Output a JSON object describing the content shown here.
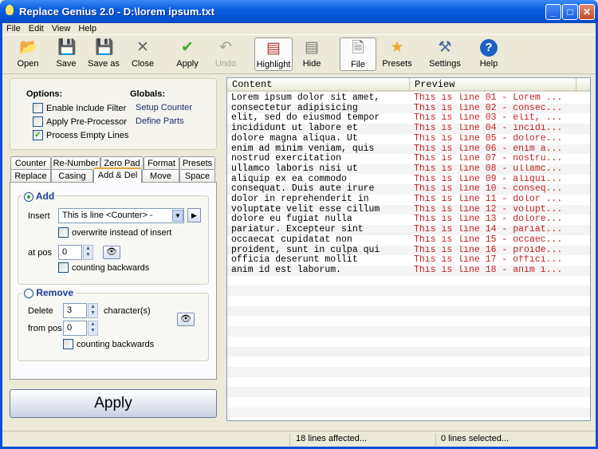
{
  "window": {
    "title": "Replace Genius 2.0 - D:\\lorem ipsum.txt",
    "controls": [
      "_",
      "□",
      "✕"
    ]
  },
  "menu": [
    "File",
    "Edit",
    "View",
    "Help"
  ],
  "toolbar": [
    {
      "label": "Open",
      "icon": "open-folder-icon",
      "glyph": "📂",
      "color": "#d9a520"
    },
    {
      "label": "Save",
      "icon": "floppy-save-icon",
      "glyph": "💾",
      "color": "#3a5c9c"
    },
    {
      "label": "Save as",
      "icon": "floppy-save-as-icon",
      "glyph": "💾",
      "color": "#3a5c9c"
    },
    {
      "label": "Close",
      "icon": "close-x-icon",
      "glyph": "✕",
      "color": "#666"
    },
    {
      "label": "Apply",
      "icon": "checkmark-icon",
      "glyph": "✔",
      "color": "#3cae2c"
    },
    {
      "label": "Undo",
      "icon": "undo-icon",
      "glyph": "↶",
      "color": "#a0a0a0",
      "disabled": true
    },
    {
      "label": "Highlight",
      "icon": "highlight-list-icon",
      "glyph": "▤",
      "color": "#b03030",
      "pressed": true
    },
    {
      "label": "Hide",
      "icon": "hide-list-icon",
      "glyph": "▤",
      "color": "#777"
    },
    {
      "label": "File",
      "icon": "file-icon",
      "glyph": "🗎",
      "color": "#666",
      "pressed": true
    },
    {
      "label": "Presets",
      "icon": "star-icon",
      "glyph": "★",
      "color": "#f5a623"
    },
    {
      "label": "Settings",
      "icon": "tools-icon",
      "glyph": "⚒",
      "color": "#4a6a9a"
    },
    {
      "label": "Help",
      "icon": "help-icon",
      "glyph": "?",
      "color": "#1e5fc4"
    }
  ],
  "options": {
    "title": "Options:",
    "items": [
      {
        "label": "Enable Include Filter",
        "checked": false
      },
      {
        "label": "Apply Pre-Processor",
        "checked": false
      },
      {
        "label": "Process Empty Lines",
        "checked": true
      }
    ]
  },
  "globals": {
    "title": "Globals:",
    "items": [
      "Setup Counter",
      "Define Parts"
    ]
  },
  "tabs": {
    "row1": [
      "Counter",
      "Re-Number",
      "Zero Pad",
      "Format",
      "Presets"
    ],
    "row2": [
      "Replace",
      "Casing",
      "Add & Del",
      "Move",
      "Space"
    ],
    "active": "Add & Del"
  },
  "add": {
    "title": "Add",
    "selected": true,
    "insert_label": "Insert",
    "insert_value": "This is line <Counter> -",
    "overwrite_label": "overwrite instead of insert",
    "overwrite": false,
    "atpos_label": "at pos",
    "atpos_value": "0",
    "backwards_label": "counting backwards",
    "backwards": false
  },
  "remove": {
    "title": "Remove",
    "selected": false,
    "delete_label": "Delete",
    "delete_value": "3",
    "chars_label": "character(s)",
    "frompos_label": "from pos",
    "frompos_value": "0",
    "backwards_label": "counting backwards",
    "backwards": false
  },
  "apply_button": "Apply",
  "list": {
    "columns": [
      "Content",
      "Preview"
    ],
    "rows": [
      [
        "Lorem ipsum dolor sit amet,",
        "This is line 01 - Lorem ..."
      ],
      [
        "consectetur adipisicing",
        "This is line 02 - consec..."
      ],
      [
        "elit, sed do eiusmod tempor",
        "This is line 03 - elit, ..."
      ],
      [
        "incididunt ut labore et",
        "This is line 04 - incidi..."
      ],
      [
        "dolore magna aliqua. Ut",
        "This is line 05 - dolore..."
      ],
      [
        "enim ad minim veniam, quis",
        "This is line 06 - enim a..."
      ],
      [
        "nostrud exercitation",
        "This is line 07 - nostru..."
      ],
      [
        "ullamco laboris nisi ut",
        "This is line 08 - ullamc..."
      ],
      [
        "aliquip ex ea commodo",
        "This is line 09 - aliqui..."
      ],
      [
        "consequat. Duis aute irure",
        "This is line 10 - conseq..."
      ],
      [
        "dolor in reprehenderit in",
        "This is line 11 - dolor ..."
      ],
      [
        "voluptate velit esse cillum",
        "This is line 12 - volupt..."
      ],
      [
        "dolore eu fugiat nulla",
        "This is line 13 - dolore..."
      ],
      [
        "pariatur. Excepteur sint",
        "This is line 14 - pariat..."
      ],
      [
        "occaecat cupidatat non",
        "This is line 15 - occaec..."
      ],
      [
        "proident, sunt in culpa qui",
        "This is line 16 - proide..."
      ],
      [
        "officia deserunt mollit",
        "This is line 17 - offici..."
      ],
      [
        "anim id est laborum.",
        "This is line 18 - anim i..."
      ]
    ]
  },
  "status": {
    "affected": "18 lines affected...",
    "selected": "0 lines selected..."
  }
}
